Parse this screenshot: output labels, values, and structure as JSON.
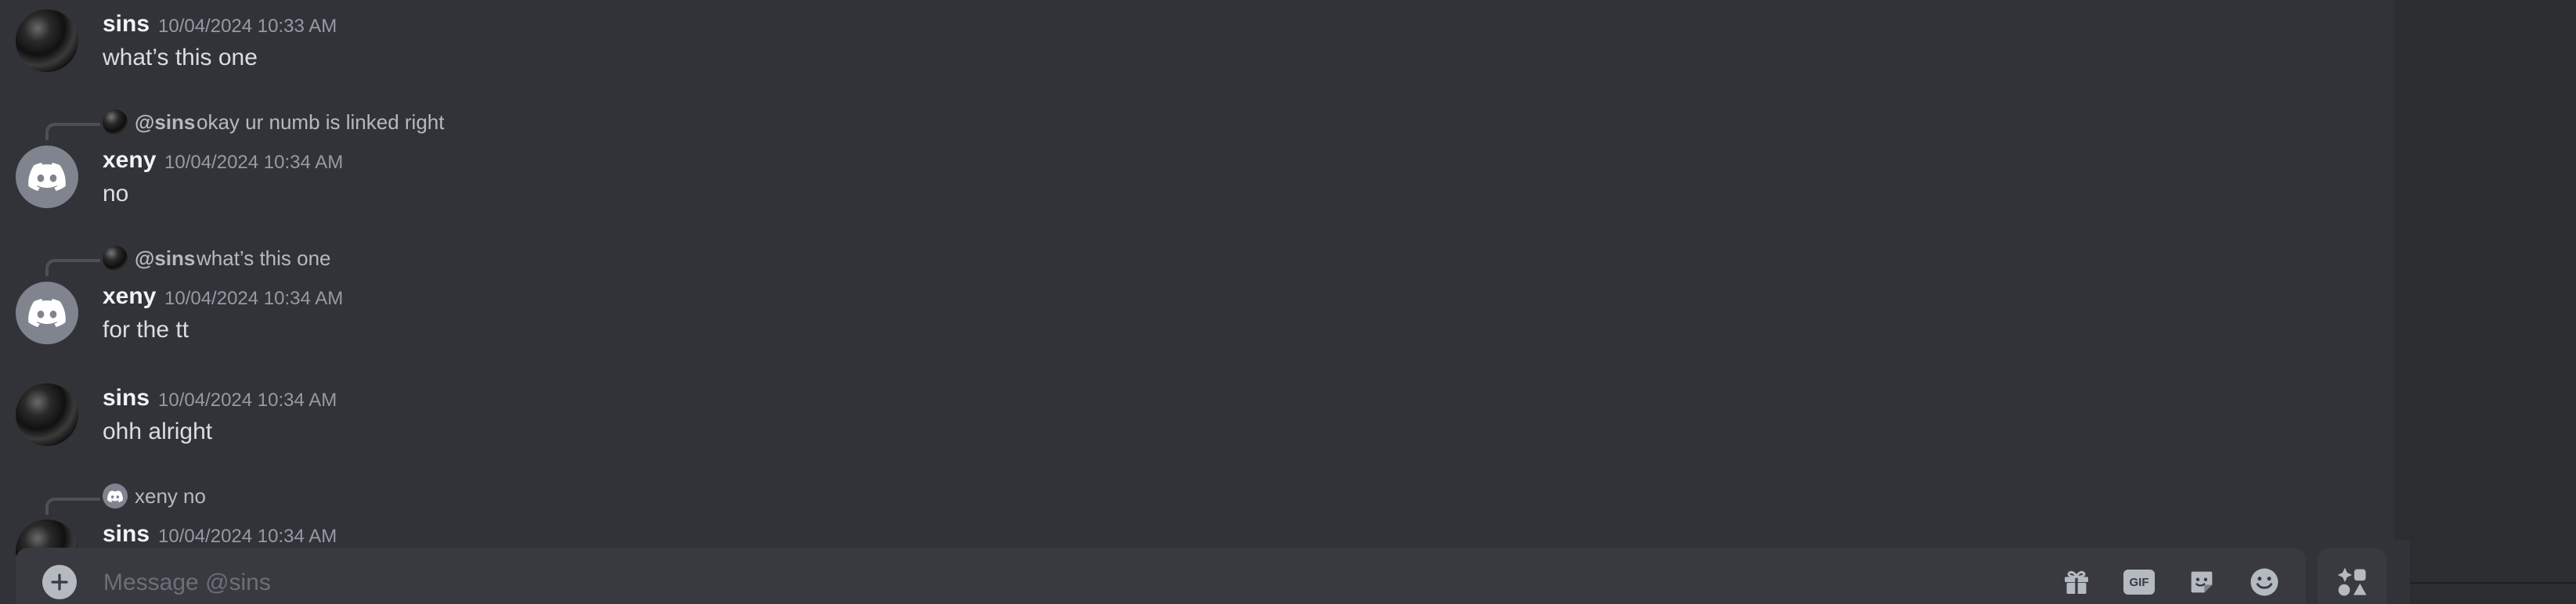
{
  "messages": [
    {
      "username": "sins",
      "timestamp": "10/04/2024 10:33 AM",
      "content": "what’s this one"
    },
    {
      "reply": {
        "name": "@sins",
        "text": "okay ur numb is linked right"
      },
      "username": "xeny",
      "timestamp": "10/04/2024 10:34 AM",
      "content": "no"
    },
    {
      "reply": {
        "name": "@sins",
        "text": "what’s this one"
      },
      "username": "xeny",
      "timestamp": "10/04/2024 10:34 AM",
      "content": "for the tt"
    },
    {
      "username": "sins",
      "timestamp": "10/04/2024 10:34 AM",
      "content": "ohh alright"
    },
    {
      "reply": {
        "name": "xeny",
        "text": "no"
      },
      "username": "sins",
      "timestamp": "10/04/2024 10:34 AM",
      "content": ""
    }
  ],
  "composer": {
    "placeholder": "Message @sins",
    "gif_label": "GIF"
  },
  "colors": {
    "background": "#313338",
    "sidebar": "#2b2d31",
    "composer": "#383a40",
    "icon": "#b5bac1",
    "timestamp": "#949ba4"
  }
}
